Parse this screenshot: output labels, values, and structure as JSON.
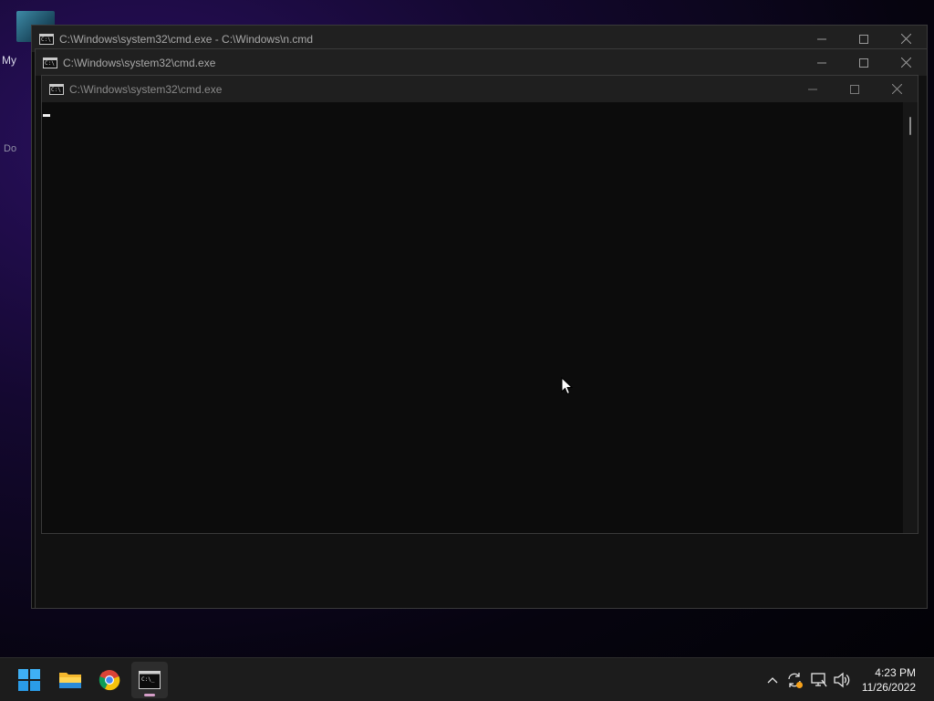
{
  "desktop": {
    "icon_label_1": "My",
    "icon_label_2": "Do"
  },
  "windows": [
    {
      "title": "C:\\Windows\\system32\\cmd.exe - C:\\Windows\\n.cmd"
    },
    {
      "title": "C:\\Windows\\system32\\cmd.exe"
    },
    {
      "title": "C:\\Windows\\system32\\cmd.exe"
    }
  ],
  "window_controls": {
    "minimize": "minimize-icon",
    "maximize": "maximize-icon",
    "close": "close-icon"
  },
  "taskbar": {
    "apps": [
      {
        "name": "Start",
        "icon": "windows-logo-icon"
      },
      {
        "name": "File Explorer",
        "icon": "folder-icon"
      },
      {
        "name": "Google Chrome",
        "icon": "chrome-icon"
      },
      {
        "name": "Command Prompt",
        "icon": "cmd-icon",
        "active": true
      }
    ],
    "tray": {
      "icons": [
        "chevron-up-icon",
        "sync-icon",
        "network-icon",
        "volume-icon"
      ]
    },
    "clock": {
      "time": "4:23 PM",
      "date": "11/26/2022"
    }
  },
  "colors": {
    "console_bg": "#0c0c0c",
    "titlebar_bg": "#202020",
    "taskbar_bg": "#1c1c1c",
    "active_indicator": "#d59ec8"
  }
}
